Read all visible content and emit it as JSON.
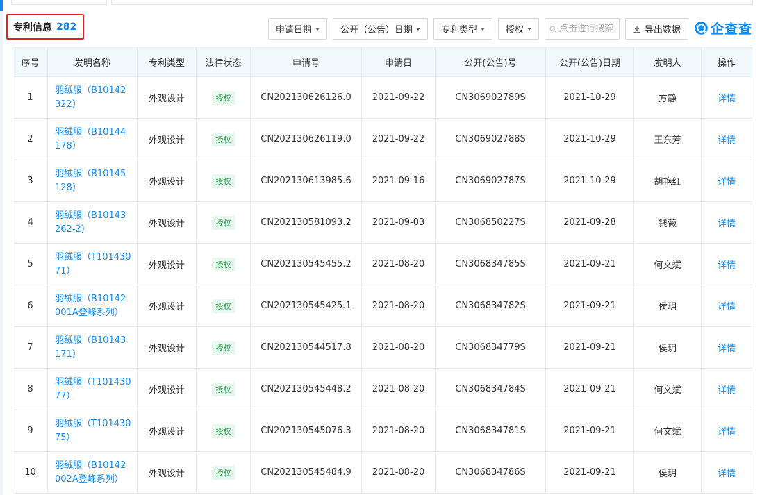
{
  "header": {
    "title": "专利信息",
    "count": "282"
  },
  "toolbar": {
    "filters": [
      "申请日期",
      "公开（公告）日期",
      "专利类型",
      "授权"
    ],
    "search_placeholder": "点击进行搜索",
    "export_label": "导出数据",
    "logo_text": "企查查"
  },
  "colors": {
    "accent": "#128bed",
    "highlight_border": "#e6221d",
    "badge_bg": "#e9f8ee",
    "badge_text": "#2e9c4f"
  },
  "table": {
    "columns": [
      "序号",
      "发明名称",
      "专利类型",
      "法律状态",
      "申请号",
      "申请日",
      "公开(公告)号",
      "公开(公告)日期",
      "发明人",
      "操作"
    ],
    "rows": [
      {
        "no": "1",
        "name": "羽绒服（B10142322）",
        "type": "外观设计",
        "status": "授权",
        "app_no": "CN202130626126.0",
        "app_date": "2021-09-22",
        "pub_no": "CN306902789S",
        "pub_date": "2021-10-29",
        "inventor": "方静",
        "action": "详情"
      },
      {
        "no": "2",
        "name": "羽绒服（B10144178）",
        "type": "外观设计",
        "status": "授权",
        "app_no": "CN202130626119.0",
        "app_date": "2021-09-22",
        "pub_no": "CN306902788S",
        "pub_date": "2021-10-29",
        "inventor": "王东芳",
        "action": "详情"
      },
      {
        "no": "3",
        "name": "羽绒服（B10145128）",
        "type": "外观设计",
        "status": "授权",
        "app_no": "CN202130613985.6",
        "app_date": "2021-09-16",
        "pub_no": "CN306902787S",
        "pub_date": "2021-10-29",
        "inventor": "胡艳红",
        "action": "详情"
      },
      {
        "no": "4",
        "name": "羽绒服（B10143262-2）",
        "type": "外观设计",
        "status": "授权",
        "app_no": "CN202130581093.2",
        "app_date": "2021-09-03",
        "pub_no": "CN306850227S",
        "pub_date": "2021-09-28",
        "inventor": "钱薇",
        "action": "详情"
      },
      {
        "no": "5",
        "name": "羽绒服（T10143071）",
        "type": "外观设计",
        "status": "授权",
        "app_no": "CN202130545455.2",
        "app_date": "2021-08-20",
        "pub_no": "CN306834785S",
        "pub_date": "2021-09-21",
        "inventor": "何文斌",
        "action": "详情"
      },
      {
        "no": "6",
        "name": "羽绒服（B10142001A登峰系列）",
        "type": "外观设计",
        "status": "授权",
        "app_no": "CN202130545425.1",
        "app_date": "2021-08-20",
        "pub_no": "CN306834782S",
        "pub_date": "2021-09-21",
        "inventor": "侯玥",
        "action": "详情"
      },
      {
        "no": "7",
        "name": "羽绒服（B10143171）",
        "type": "外观设计",
        "status": "授权",
        "app_no": "CN202130544517.8",
        "app_date": "2021-08-20",
        "pub_no": "CN306834779S",
        "pub_date": "2021-09-21",
        "inventor": "侯玥",
        "action": "详情"
      },
      {
        "no": "8",
        "name": "羽绒服（T10143077）",
        "type": "外观设计",
        "status": "授权",
        "app_no": "CN202130545448.2",
        "app_date": "2021-08-20",
        "pub_no": "CN306834784S",
        "pub_date": "2021-09-21",
        "inventor": "何文斌",
        "action": "详情"
      },
      {
        "no": "9",
        "name": "羽绒服（T10143075）",
        "type": "外观设计",
        "status": "授权",
        "app_no": "CN202130545076.3",
        "app_date": "2021-08-20",
        "pub_no": "CN306834781S",
        "pub_date": "2021-09-21",
        "inventor": "何文斌",
        "action": "详情"
      },
      {
        "no": "10",
        "name": "羽绒服（B10142002A登峰系列）",
        "type": "外观设计",
        "status": "授权",
        "app_no": "CN202130545484.9",
        "app_date": "2021-08-20",
        "pub_no": "CN306834786S",
        "pub_date": "2021-09-21",
        "inventor": "侯玥",
        "action": "详情"
      }
    ]
  }
}
